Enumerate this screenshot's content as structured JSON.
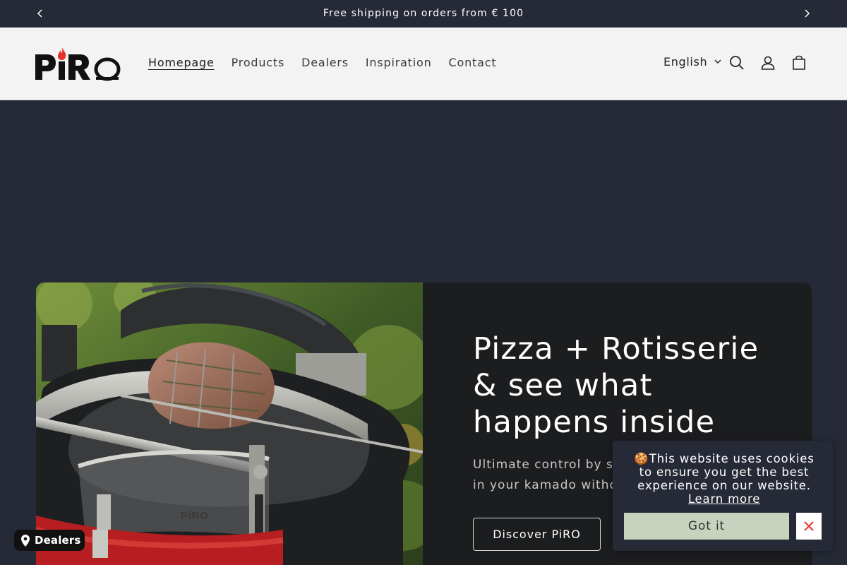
{
  "announcement": {
    "text": "Free shipping on orders from € 100",
    "prev_icon": "chevron-left-icon",
    "next_icon": "chevron-right-icon"
  },
  "header": {
    "logo_text": "PiRO",
    "nav": [
      {
        "label": "Homepage",
        "active": true
      },
      {
        "label": "Products",
        "active": false
      },
      {
        "label": "Dealers",
        "active": false
      },
      {
        "label": "Inspiration",
        "active": false
      },
      {
        "label": "Contact",
        "active": false
      }
    ],
    "language": "English",
    "icons": [
      "search-icon",
      "account-icon",
      "cart-icon"
    ]
  },
  "hero": {
    "title": "Pizza + Rotisserie & see what happens inside",
    "subtitle": "Ultimate control by see",
    "subtitle_line2": "in your kamado withou",
    "button_label": "Discover PiRO",
    "image_brand": "PiRO"
  },
  "cookie": {
    "emoji": "🍪",
    "message": "This website uses cookies to ensure you get the best experience on our website.",
    "learn_more": "Learn more",
    "accept_label": "Got it",
    "close_icon": "close-icon"
  },
  "dealers_badge": {
    "label": "Dealers",
    "icon": "map-pin-icon"
  },
  "colors": {
    "dark_bg": "#252a36",
    "header_bg": "#f3f3f3",
    "card_bg": "#1c1d1f",
    "accept_bg": "#c7d3bd",
    "accent_red": "#e4312b",
    "close_x": "#e4312b"
  }
}
